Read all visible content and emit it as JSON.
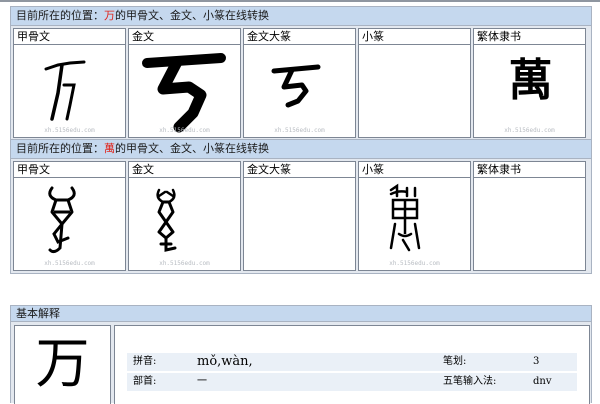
{
  "section1": {
    "title_prefix": "目前所在的位置：",
    "title_char": "万",
    "title_suffix": "的甲骨文、金文、小篆在线转换",
    "columns": [
      {
        "label": "甲骨文",
        "watermark": "xh.5156edu.com"
      },
      {
        "label": "金文",
        "watermark": "xh.5156edu.com"
      },
      {
        "label": "金文大篆",
        "watermark": "xh.5156edu.com"
      },
      {
        "label": "小篆",
        "watermark": ""
      },
      {
        "label": "繁体隶书",
        "watermark": "xh.5156edu.com",
        "glyph": "萬"
      }
    ]
  },
  "section2": {
    "title_prefix": "目前所在的位置：",
    "title_char": "萬",
    "title_suffix": "的甲骨文、金文、小篆在线转换",
    "columns": [
      {
        "label": "甲骨文",
        "watermark": "xh.5156edu.com"
      },
      {
        "label": "金文",
        "watermark": "xh.5156edu.com"
      },
      {
        "label": "金文大篆",
        "watermark": ""
      },
      {
        "label": "小篆",
        "watermark": "xh.5156edu.com"
      },
      {
        "label": "繁体隶书",
        "watermark": ""
      }
    ]
  },
  "basic": {
    "title": "基本解释",
    "char": "万",
    "pinyin_label": "拼音:",
    "pinyin_value": "mǒ,wàn,",
    "strokes_label": "笔划:",
    "strokes_value": "3",
    "radical_label": "部首:",
    "radical_value": "一",
    "wubi_label": "五笔输入法:",
    "wubi_value": "dnv"
  }
}
